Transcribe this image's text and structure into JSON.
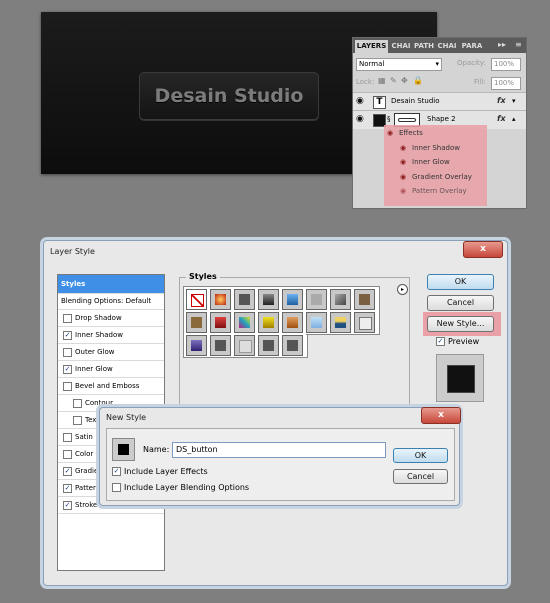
{
  "canvas": {
    "button_text": "Desain Studio"
  },
  "layers_panel": {
    "tabs": [
      "LAYERS",
      "CHAI",
      "PATH",
      "CHAI",
      "PARA"
    ],
    "blend_mode": "Normal",
    "opacity_label": "Opacity:",
    "opacity_value": "100%",
    "lock_label": "Lock:",
    "fill_label": "Fill:",
    "fill_value": "100%",
    "layers": [
      {
        "name": "Desain Studio",
        "type_icon": "T",
        "fx": "fx"
      },
      {
        "name": "Shape 2",
        "fx": "fx"
      }
    ],
    "effects_label": "Effects",
    "effects": [
      "Inner Shadow",
      "Inner Glow",
      "Gradient Overlay",
      "Pattern Overlay"
    ]
  },
  "layer_style": {
    "title": "Layer Style",
    "close": "x",
    "list": [
      {
        "label": "Styles",
        "selected": true
      },
      {
        "label": "Blending Options: Default"
      },
      {
        "label": "Drop Shadow",
        "checked": false
      },
      {
        "label": "Inner Shadow",
        "checked": true
      },
      {
        "label": "Outer Glow",
        "checked": false
      },
      {
        "label": "Inner Glow",
        "checked": true
      },
      {
        "label": "Bevel and Emboss",
        "checked": false
      },
      {
        "label": "Contour",
        "checked": false,
        "indent": true
      },
      {
        "label": "Text",
        "checked": false,
        "indent": true
      },
      {
        "label": "Satin",
        "checked": false
      },
      {
        "label": "Color O",
        "checked": false
      },
      {
        "label": "Gradien",
        "checked": true
      },
      {
        "label": "Pattern",
        "checked": true
      },
      {
        "label": "Stroke",
        "checked": true
      }
    ],
    "styles_label": "Styles",
    "ok": "OK",
    "cancel": "Cancel",
    "new_style": "New Style...",
    "preview_label": "Preview",
    "preview_checked": true
  },
  "new_style": {
    "title": "New Style",
    "close": "x",
    "name_label": "Name:",
    "name_value": "DS_button",
    "include_effects": "Include Layer Effects",
    "include_effects_checked": true,
    "include_blending": "Include Layer Blending Options",
    "include_blending_checked": false,
    "ok": "OK",
    "cancel": "Cancel"
  },
  "colors": {
    "highlight": "#e9a0a6",
    "list_selected": "#3f8fe6",
    "close_red": "#c7473a"
  }
}
